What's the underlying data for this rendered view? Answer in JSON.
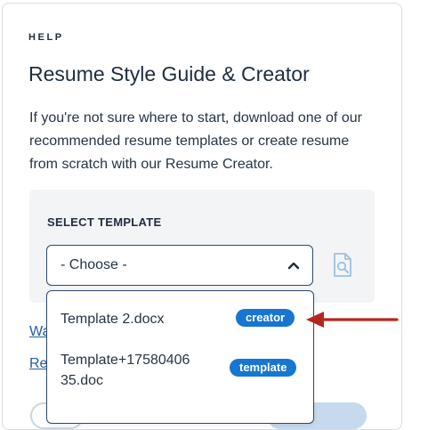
{
  "section": {
    "eyebrow": "HELP",
    "title": "Resume Style Guide & Creator",
    "description": "If you're not sure where to start, download one of our recommended resume templates or create resume from scratch with our Resume Creator."
  },
  "select": {
    "label": "SELECT TEMPLATE",
    "value": "- Choose -",
    "expanded": true,
    "options": [
      {
        "label": "Template 2.docx",
        "badge": "creator"
      },
      {
        "label": "Template+1758040635.doc",
        "badge": "template"
      }
    ]
  },
  "links": {
    "first_partial": "Wa",
    "second_partial": "Re"
  },
  "icons": {
    "chevron": "chevron-up-icon",
    "preview": "document-search-icon",
    "annotation": "red-arrow-icon"
  },
  "colors": {
    "badge": "#1676d2",
    "border": "#2b4a6b",
    "panel": "#f3f4f6",
    "arrow": "#b3261e",
    "link": "#1f5fa8"
  }
}
